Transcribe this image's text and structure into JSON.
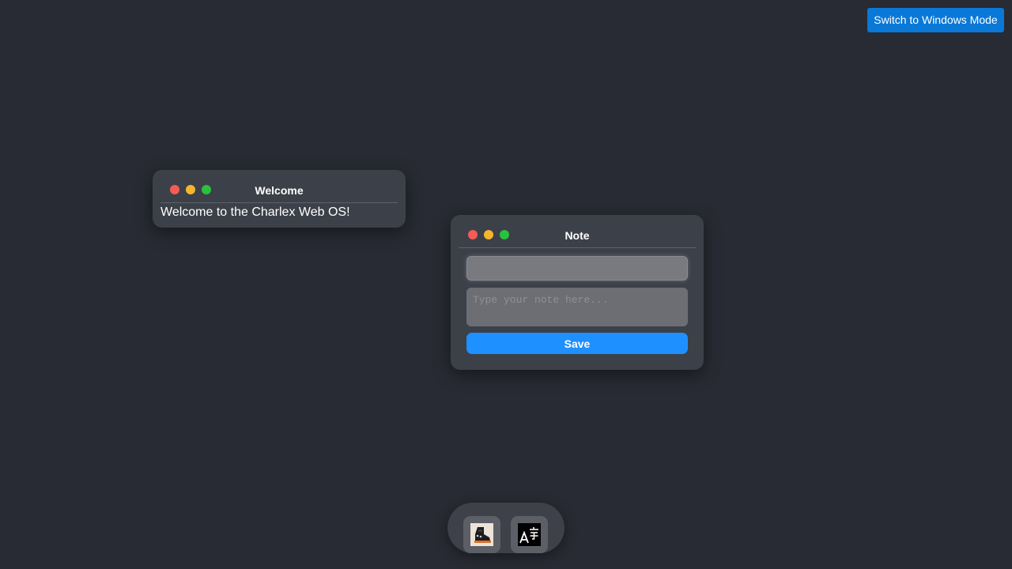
{
  "top_bar": {
    "mode_switch_label": "Switch to Windows Mode"
  },
  "welcome_window": {
    "title": "Welcome",
    "message": "Welcome to the Charlex Web OS!"
  },
  "note_window": {
    "title": "Note",
    "title_input_value": "",
    "textarea_placeholder": "Type your note here...",
    "save_label": "Save"
  },
  "dock": {
    "items": [
      {
        "icon": "boot-app-icon"
      },
      {
        "icon": "translate-app-icon"
      }
    ]
  },
  "colors": {
    "desktop_bg": "#282b33",
    "window_bg": "#3c4049",
    "accent_blue": "#1e90ff",
    "mode_button_blue": "#0a78d7",
    "close_red": "#f45c55",
    "minimize_yellow": "#f5b62d",
    "maximize_green": "#2ac13f"
  }
}
